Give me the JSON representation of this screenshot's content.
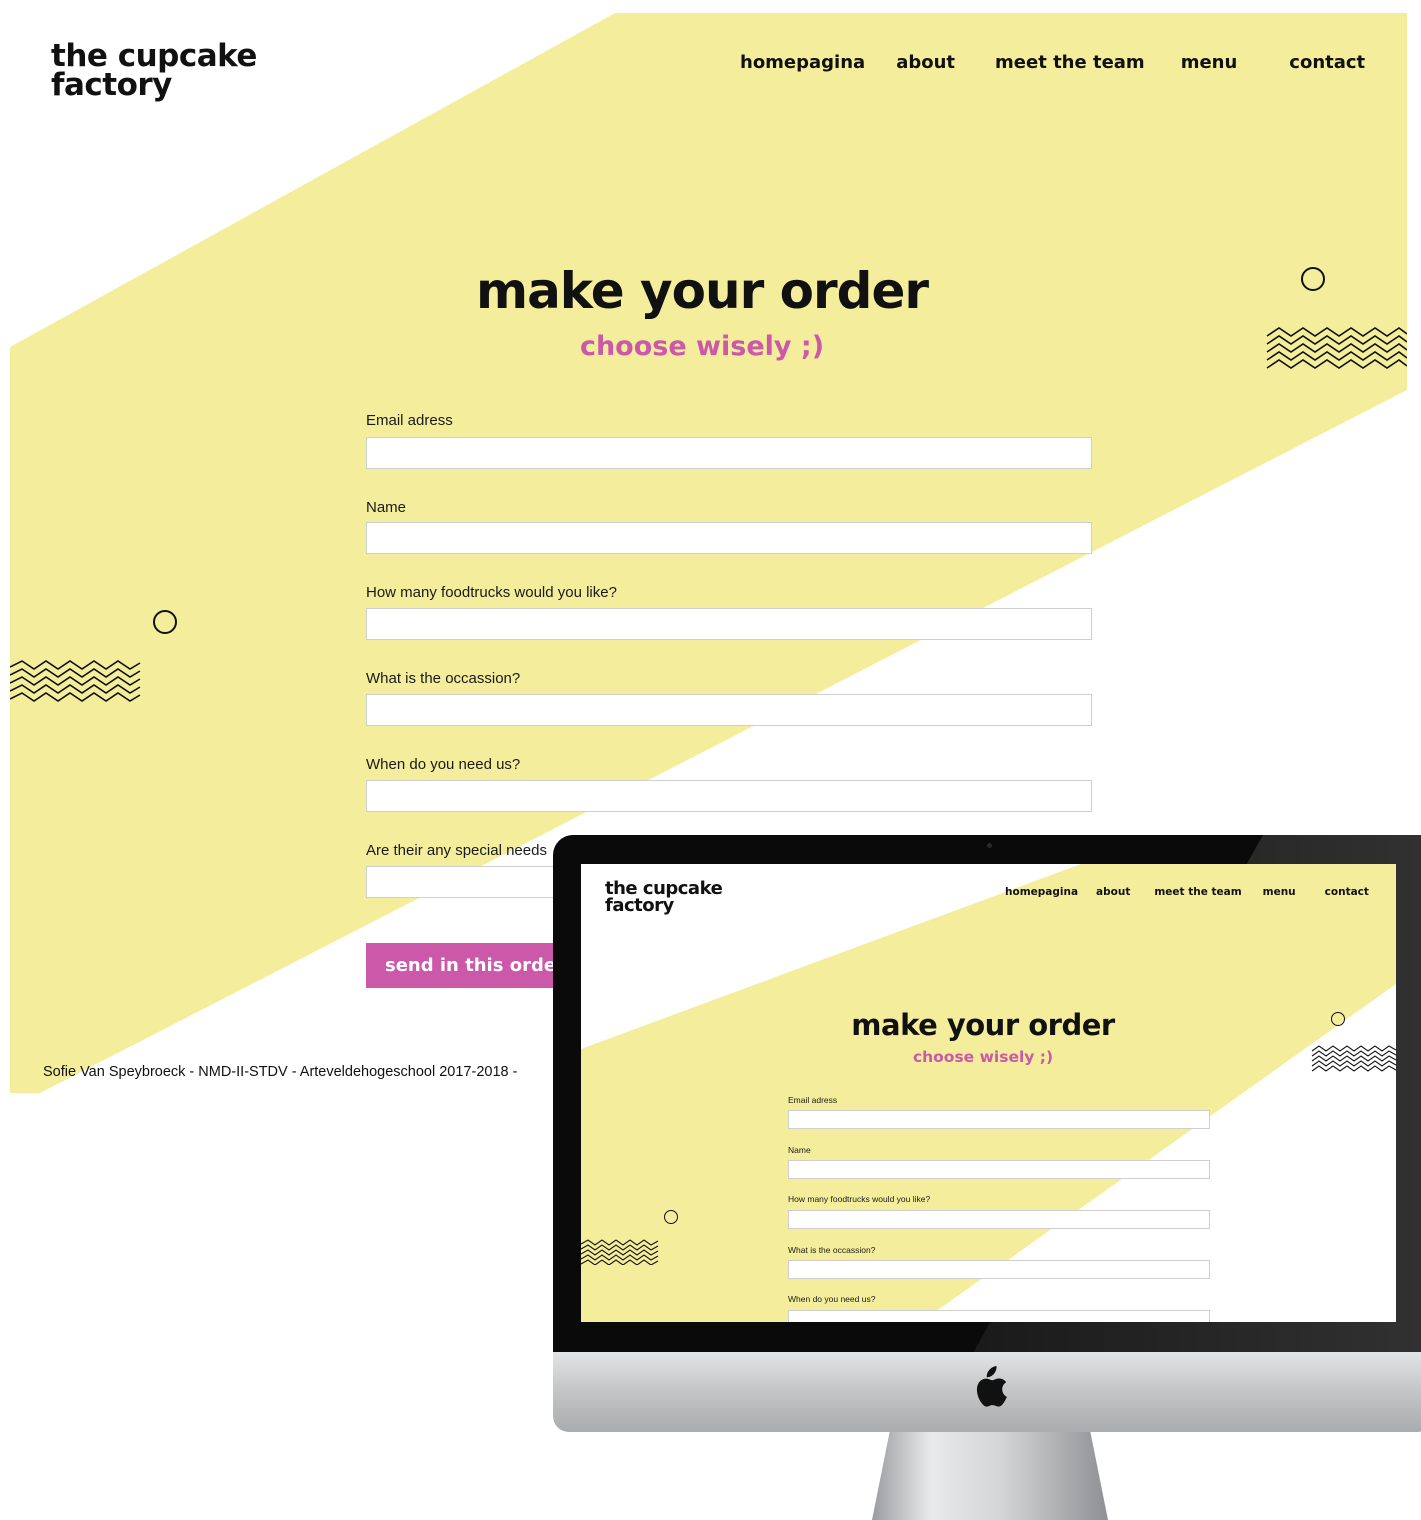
{
  "site": {
    "logo_line1": "the cupcake",
    "logo_line2": "factory",
    "nav": [
      {
        "label": "homepagina"
      },
      {
        "label": "about"
      },
      {
        "label": "meet the team"
      },
      {
        "label": "menu"
      },
      {
        "label": "contact"
      }
    ],
    "title": "make your order",
    "subtitle": "choose wisely ;)",
    "fields": [
      {
        "label": "Email adress",
        "value": ""
      },
      {
        "label": "Name",
        "value": ""
      },
      {
        "label": "How many foodtrucks would you like?",
        "value": ""
      },
      {
        "label": "What is the occassion?",
        "value": ""
      },
      {
        "label": "When do you need us?",
        "value": ""
      },
      {
        "label": "Are their any special needs",
        "value": ""
      }
    ],
    "submit_label": "send in this order",
    "footer": "Sofie Van Speybroeck - NMD-II-STDV - Arteveldehogeschool 2017-2018 -"
  },
  "colors": {
    "yellow": "#f4ee9c",
    "pink": "#cb58a8",
    "text": "#111111",
    "imac_silver": "#c7c9cb",
    "imac_bezel": "#0a0a0a"
  },
  "icons": {
    "circle": "circle-outline-icon",
    "zigzag": "zigzag-lines-icon",
    "apple": "apple-logo-icon"
  }
}
